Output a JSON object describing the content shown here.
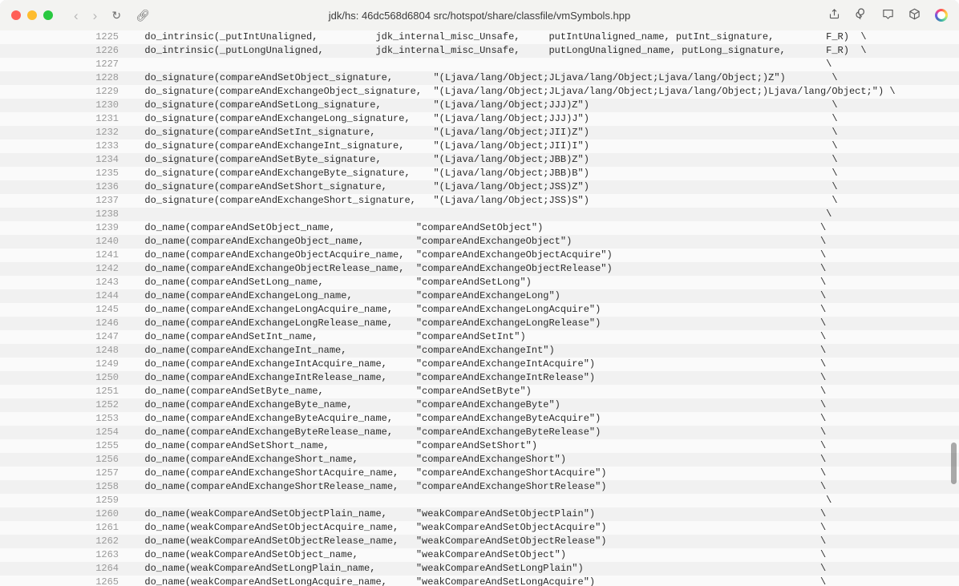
{
  "title": "jdk/hs: 46dc568d6804 src/hotspot/share/classfile/vmSymbols.hpp",
  "lines": [
    {
      "n": 1225,
      "t": "  do_intrinsic(_putIntUnaligned,          jdk_internal_misc_Unsafe,     putIntUnaligned_name, putInt_signature,         F_R)  \\"
    },
    {
      "n": 1226,
      "t": "  do_intrinsic(_putLongUnaligned,         jdk_internal_misc_Unsafe,     putLongUnaligned_name, putLong_signature,       F_R)  \\"
    },
    {
      "n": 1227,
      "t": "                                                                                                                        \\"
    },
    {
      "n": 1228,
      "t": "  do_signature(compareAndSetObject_signature,       \"(Ljava/lang/Object;JLjava/lang/Object;Ljava/lang/Object;)Z\")        \\"
    },
    {
      "n": 1229,
      "t": "  do_signature(compareAndExchangeObject_signature,  \"(Ljava/lang/Object;JLjava/lang/Object;Ljava/lang/Object;)Ljava/lang/Object;\") \\"
    },
    {
      "n": 1230,
      "t": "  do_signature(compareAndSetLong_signature,         \"(Ljava/lang/Object;JJJ)Z\")                                          \\"
    },
    {
      "n": 1231,
      "t": "  do_signature(compareAndExchangeLong_signature,    \"(Ljava/lang/Object;JJJ)J\")                                          \\"
    },
    {
      "n": 1232,
      "t": "  do_signature(compareAndSetInt_signature,          \"(Ljava/lang/Object;JII)Z\")                                          \\"
    },
    {
      "n": 1233,
      "t": "  do_signature(compareAndExchangeInt_signature,     \"(Ljava/lang/Object;JII)I\")                                          \\"
    },
    {
      "n": 1234,
      "t": "  do_signature(compareAndSetByte_signature,         \"(Ljava/lang/Object;JBB)Z\")                                          \\"
    },
    {
      "n": 1235,
      "t": "  do_signature(compareAndExchangeByte_signature,    \"(Ljava/lang/Object;JBB)B\")                                          \\"
    },
    {
      "n": 1236,
      "t": "  do_signature(compareAndSetShort_signature,        \"(Ljava/lang/Object;JSS)Z\")                                          \\"
    },
    {
      "n": 1237,
      "t": "  do_signature(compareAndExchangeShort_signature,   \"(Ljava/lang/Object;JSS)S\")                                          \\"
    },
    {
      "n": 1238,
      "t": "                                                                                                                        \\"
    },
    {
      "n": 1239,
      "t": "  do_name(compareAndSetObject_name,              \"compareAndSetObject\")                                                \\"
    },
    {
      "n": 1240,
      "t": "  do_name(compareAndExchangeObject_name,         \"compareAndExchangeObject\")                                           \\"
    },
    {
      "n": 1241,
      "t": "  do_name(compareAndExchangeObjectAcquire_name,  \"compareAndExchangeObjectAcquire\")                                    \\"
    },
    {
      "n": 1242,
      "t": "  do_name(compareAndExchangeObjectRelease_name,  \"compareAndExchangeObjectRelease\")                                    \\"
    },
    {
      "n": 1243,
      "t": "  do_name(compareAndSetLong_name,                \"compareAndSetLong\")                                                  \\"
    },
    {
      "n": 1244,
      "t": "  do_name(compareAndExchangeLong_name,           \"compareAndExchangeLong\")                                             \\"
    },
    {
      "n": 1245,
      "t": "  do_name(compareAndExchangeLongAcquire_name,    \"compareAndExchangeLongAcquire\")                                      \\"
    },
    {
      "n": 1246,
      "t": "  do_name(compareAndExchangeLongRelease_name,    \"compareAndExchangeLongRelease\")                                      \\"
    },
    {
      "n": 1247,
      "t": "  do_name(compareAndSetInt_name,                 \"compareAndSetInt\")                                                   \\"
    },
    {
      "n": 1248,
      "t": "  do_name(compareAndExchangeInt_name,            \"compareAndExchangeInt\")                                              \\"
    },
    {
      "n": 1249,
      "t": "  do_name(compareAndExchangeIntAcquire_name,     \"compareAndExchangeIntAcquire\")                                       \\"
    },
    {
      "n": 1250,
      "t": "  do_name(compareAndExchangeIntRelease_name,     \"compareAndExchangeIntRelease\")                                       \\"
    },
    {
      "n": 1251,
      "t": "  do_name(compareAndSetByte_name,                \"compareAndSetByte\")                                                  \\"
    },
    {
      "n": 1252,
      "t": "  do_name(compareAndExchangeByte_name,           \"compareAndExchangeByte\")                                             \\"
    },
    {
      "n": 1253,
      "t": "  do_name(compareAndExchangeByteAcquire_name,    \"compareAndExchangeByteAcquire\")                                      \\"
    },
    {
      "n": 1254,
      "t": "  do_name(compareAndExchangeByteRelease_name,    \"compareAndExchangeByteRelease\")                                      \\"
    },
    {
      "n": 1255,
      "t": "  do_name(compareAndSetShort_name,               \"compareAndSetShort\")                                                 \\"
    },
    {
      "n": 1256,
      "t": "  do_name(compareAndExchangeShort_name,          \"compareAndExchangeShort\")                                            \\"
    },
    {
      "n": 1257,
      "t": "  do_name(compareAndExchangeShortAcquire_name,   \"compareAndExchangeShortAcquire\")                                     \\"
    },
    {
      "n": 1258,
      "t": "  do_name(compareAndExchangeShortRelease_name,   \"compareAndExchangeShortRelease\")                                     \\"
    },
    {
      "n": 1259,
      "t": "                                                                                                                        \\"
    },
    {
      "n": 1260,
      "t": "  do_name(weakCompareAndSetObjectPlain_name,     \"weakCompareAndSetObjectPlain\")                                       \\"
    },
    {
      "n": 1261,
      "t": "  do_name(weakCompareAndSetObjectAcquire_name,   \"weakCompareAndSetObjectAcquire\")                                     \\"
    },
    {
      "n": 1262,
      "t": "  do_name(weakCompareAndSetObjectRelease_name,   \"weakCompareAndSetObjectRelease\")                                     \\"
    },
    {
      "n": 1263,
      "t": "  do_name(weakCompareAndSetObject_name,          \"weakCompareAndSetObject\")                                            \\"
    },
    {
      "n": 1264,
      "t": "  do_name(weakCompareAndSetLongPlain_name,       \"weakCompareAndSetLongPlain\")                                         \\"
    },
    {
      "n": 1265,
      "t": "  do_name(weakCompareAndSetLongAcquire_name,     \"weakCompareAndSetLongAcquire\")                                       \\"
    }
  ]
}
